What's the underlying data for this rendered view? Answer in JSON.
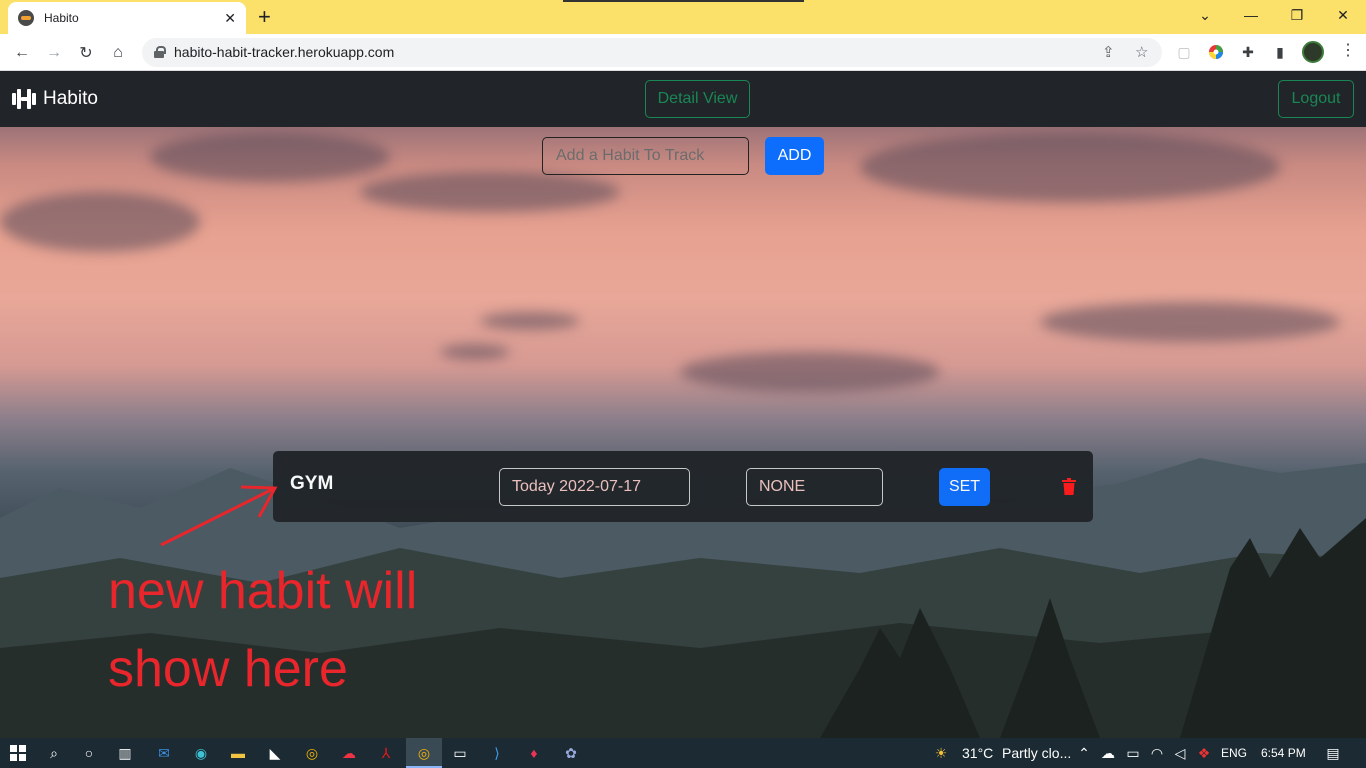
{
  "browser": {
    "tab_title": "Habito",
    "url": "habito-habit-tracker.herokuapp.com"
  },
  "navbar": {
    "brand": "Habito",
    "detail_view_label": "Detail View",
    "logout_label": "Logout"
  },
  "add_habit": {
    "placeholder": "Add a Habit To Track",
    "button_label": "ADD"
  },
  "habits": [
    {
      "name": "GYM",
      "date": "Today 2022-07-17",
      "status": "NONE",
      "set_label": "SET"
    }
  ],
  "annotation": "new habit will show here",
  "taskbar": {
    "temperature": "31°C",
    "weather": "Partly clo...",
    "language": "ENG",
    "time": "6:54 PM"
  },
  "colors": {
    "primary": "#0d6efd",
    "success": "#198754",
    "danger": "#dc3545",
    "navbar": "#212529",
    "annotation": "#e8262c"
  }
}
